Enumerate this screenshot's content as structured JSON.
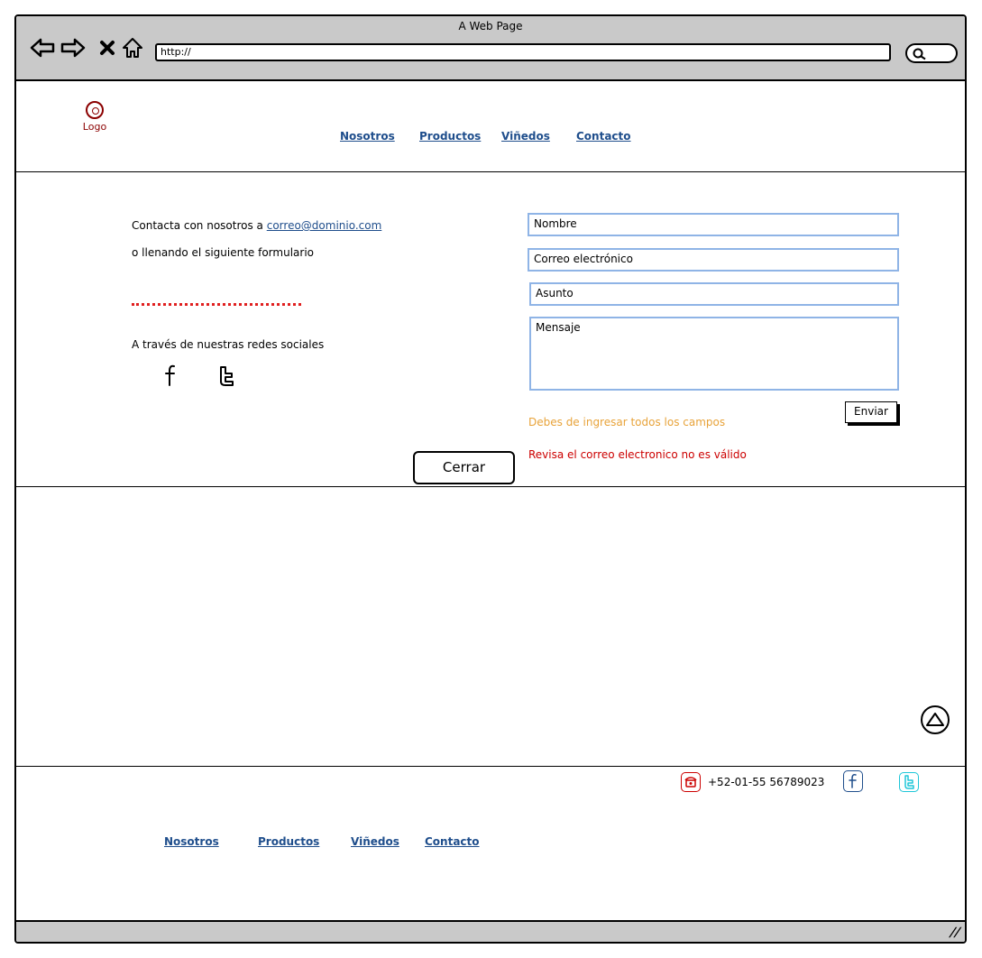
{
  "window": {
    "title": "A Web Page",
    "url": "http://"
  },
  "header": {
    "logo_label": "Logo",
    "nav": [
      "Nosotros",
      "Productos",
      "Viñedos",
      "Contacto"
    ]
  },
  "contact": {
    "intro_text": "Contacta con nosotros a",
    "email": "correo@dominio.com",
    "intro_text_2": "o llenando el siguiente formulario",
    "social_text": "A través de nuestras redes sociales"
  },
  "form": {
    "name_placeholder": "Nombre",
    "email_placeholder": "Correo electrónico",
    "subject_placeholder": "Asunto",
    "message_placeholder": "Mensaje",
    "send_label": "Enviar",
    "warning_required": "Debes de ingresar todos los campos",
    "error_email": "Revisa el correo electronico no es válido",
    "warning_color": "#e8a33a",
    "error_color": "#cc0000"
  },
  "close_label": "Cerrar",
  "footer": {
    "phone": "+52-01-55 56789023",
    "nav": [
      "Nosotros",
      "Productos",
      "Viñedos",
      "Contacto"
    ]
  },
  "colors": {
    "link": "#1f4e8c",
    "logo": "#8b0000",
    "field_border": "#8fb4e6",
    "separator": "#e02020",
    "twitter_footer": "#1ec6d8",
    "phone_icon": "#cc0000"
  }
}
